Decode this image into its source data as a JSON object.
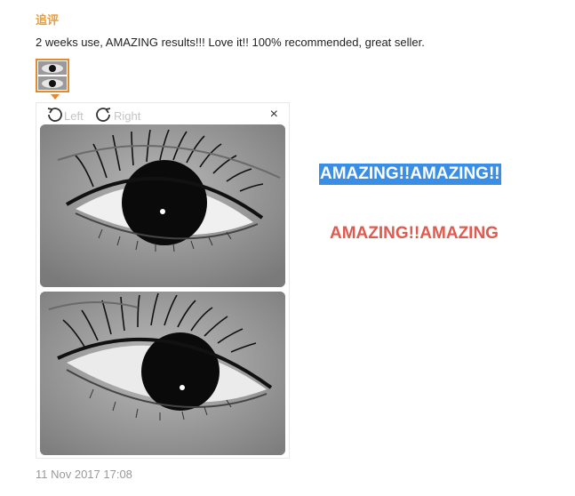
{
  "review": {
    "followup_label": "追评",
    "text": "2 weeks use, AMAZING results!!! Love it!! 100% recommended, great seller.",
    "date": "11 Nov 2017 17:08"
  },
  "viewer": {
    "rotate_left_label": "Left",
    "rotate_right_label": "Right",
    "close_label": "×"
  },
  "overlays": {
    "highlighted_text": "AMAZING!!AMAZING!!",
    "red_text": "AMAZING!!AMAZING"
  },
  "icons": {
    "rotate_left": "rotate-left-icon",
    "rotate_right": "rotate-right-icon",
    "close": "close-icon"
  },
  "colors": {
    "accent": "#e28a32",
    "highlight_bg": "#3a8ee6",
    "red_text": "#e05a4e",
    "muted": "#999999"
  }
}
